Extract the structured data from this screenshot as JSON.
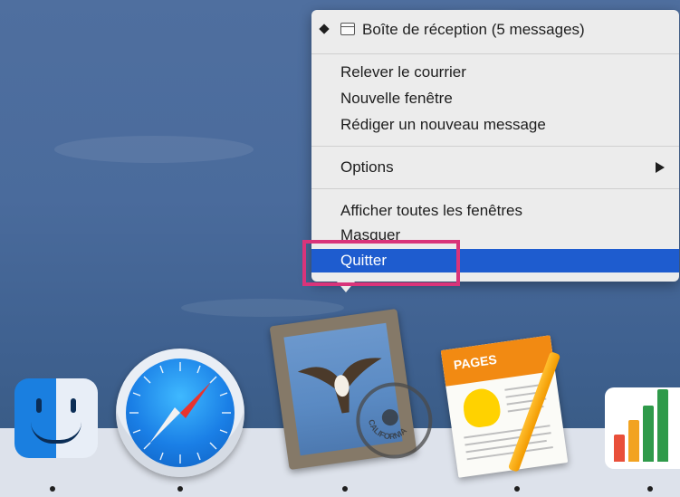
{
  "menu": {
    "header_item": "Boîte de réception (5 messages)",
    "items": [
      "Relever le courrier",
      "Nouvelle fenêtre",
      "Rédiger un nouveau message"
    ],
    "options": "Options",
    "show_all_windows": "Afficher toutes les fenêtres",
    "hide": "Masquer",
    "quit": "Quitter"
  },
  "dock": {
    "apps": [
      "finder-icon",
      "safari-icon",
      "mail-icon",
      "pages-icon",
      "numbers-icon"
    ],
    "pages_banner": "PAGES",
    "postmark_text": "CALIFORNIA"
  },
  "colors": {
    "selected": "#1e5ccf",
    "highlight": "#d9347a",
    "menu_bg": "#ececec"
  }
}
